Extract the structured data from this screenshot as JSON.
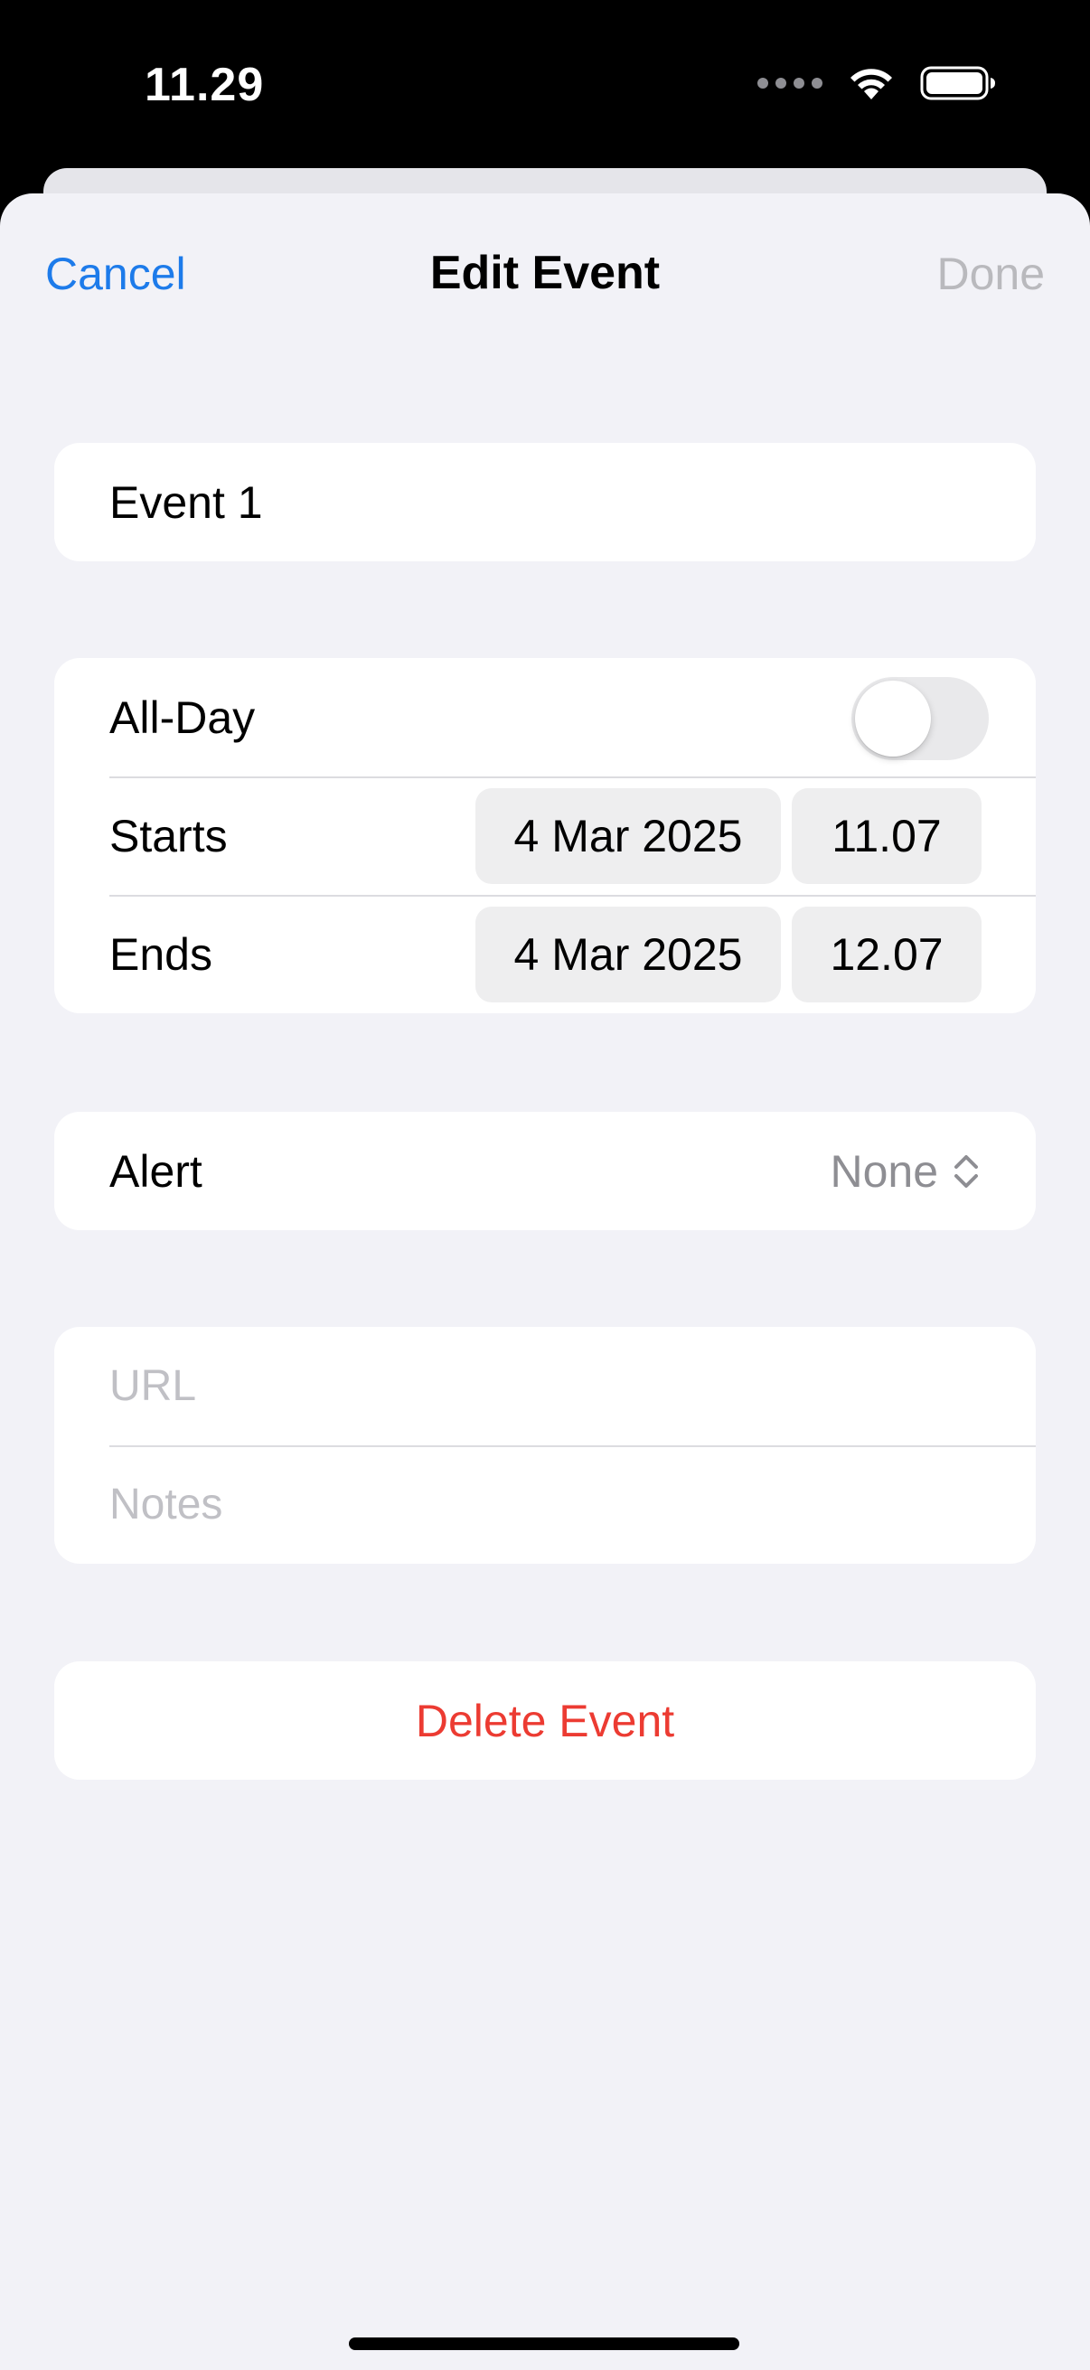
{
  "status_bar": {
    "time": "11.29",
    "icons": [
      "signal-dots-icon",
      "wifi-icon",
      "battery-icon"
    ]
  },
  "nav": {
    "cancel_label": "Cancel",
    "title": "Edit Event",
    "done_label": "Done"
  },
  "form": {
    "title_value": "Event 1",
    "all_day": {
      "label": "All-Day",
      "enabled": false
    },
    "starts": {
      "label": "Starts",
      "date": "4 Mar 2025",
      "time": "11.07"
    },
    "ends": {
      "label": "Ends",
      "date": "4 Mar 2025",
      "time": "12.07"
    },
    "alert": {
      "label": "Alert",
      "value": "None",
      "icon": "chevron-up-down-icon"
    },
    "url_placeholder": "URL",
    "notes_placeholder": "Notes"
  },
  "delete_label": "Delete Event",
  "colors": {
    "accent": "#1d7bea",
    "destructive": "#ec3b32",
    "disabled": "#b9b9bd",
    "background": "#f2f2f7"
  }
}
